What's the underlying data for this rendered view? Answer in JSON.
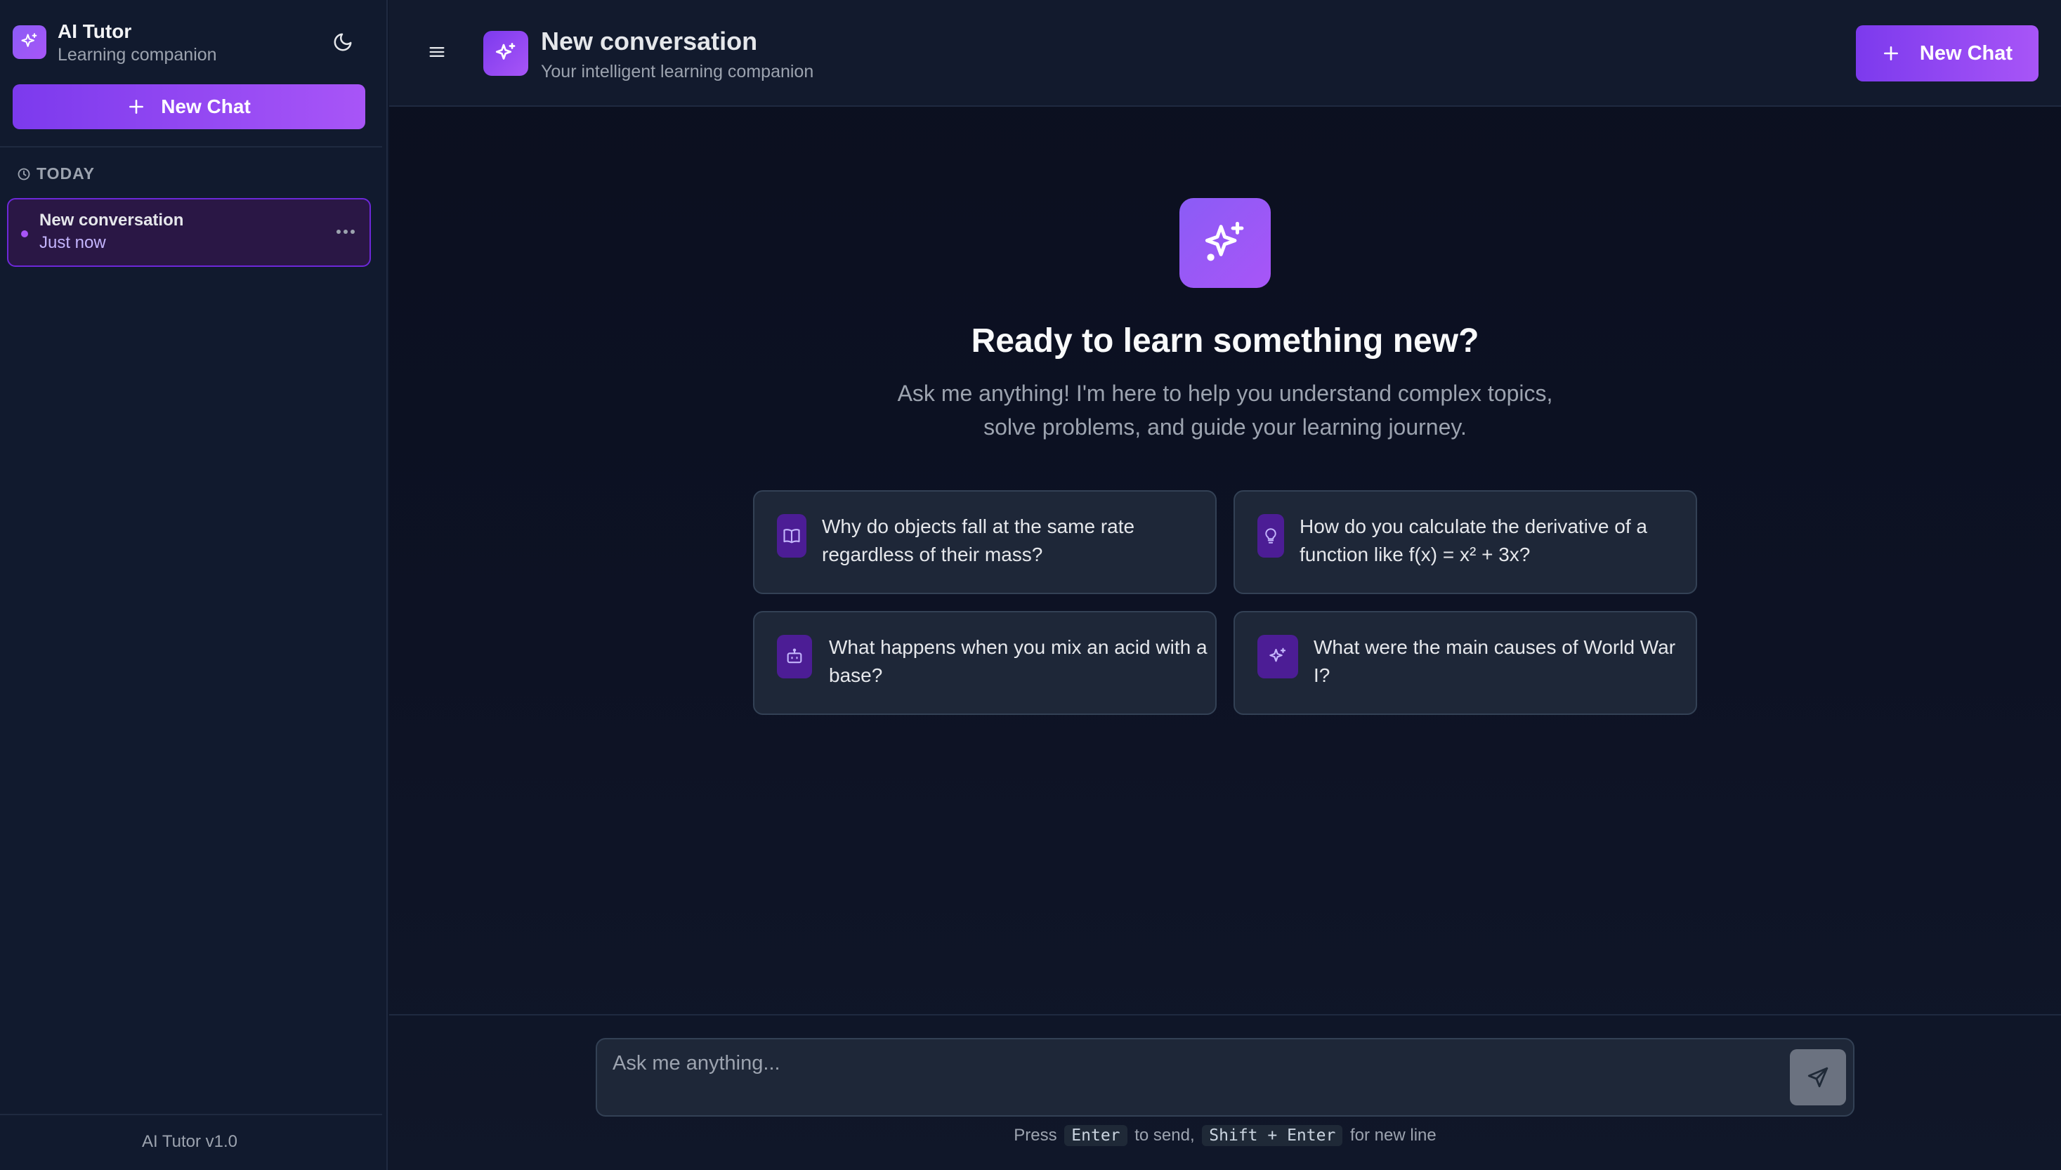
{
  "sidebar": {
    "brand_title": "AI Tutor",
    "brand_subtitle": "Learning companion",
    "new_chat_label": "New Chat",
    "section_label": "TODAY",
    "conversations": [
      {
        "title": "New conversation",
        "time": "Just now"
      }
    ],
    "version": "AI Tutor v1.0"
  },
  "header": {
    "title": "New conversation",
    "subtitle": "Your intelligent learning companion",
    "new_chat_label": "New Chat"
  },
  "hero": {
    "title": "Ready to learn something new?",
    "subtitle": "Ask me anything! I'm here to help you understand complex topics, solve problems, and guide your learning journey."
  },
  "suggestions": [
    {
      "icon": "book-icon",
      "text": "Why do objects fall at the same rate regardless of their mass?"
    },
    {
      "icon": "lightbulb-icon",
      "text": "How do you calculate the derivative of a function like f(x) = x² + 3x?"
    },
    {
      "icon": "robot-icon",
      "text": "What happens when you mix an acid with a base?"
    },
    {
      "icon": "sparkles-icon",
      "text": "What were the main causes of World War I?"
    }
  ],
  "composer": {
    "placeholder": "Ask me anything...",
    "hint_press": "Press",
    "hint_enter": "Enter",
    "hint_to_send": "to send,",
    "hint_shift_enter": "Shift + Enter",
    "hint_new_line": "for new line"
  },
  "colors": {
    "accent": "#8b5cf6",
    "accent_2": "#a855f7",
    "background": "#0f172a",
    "card": "#1e2738"
  }
}
